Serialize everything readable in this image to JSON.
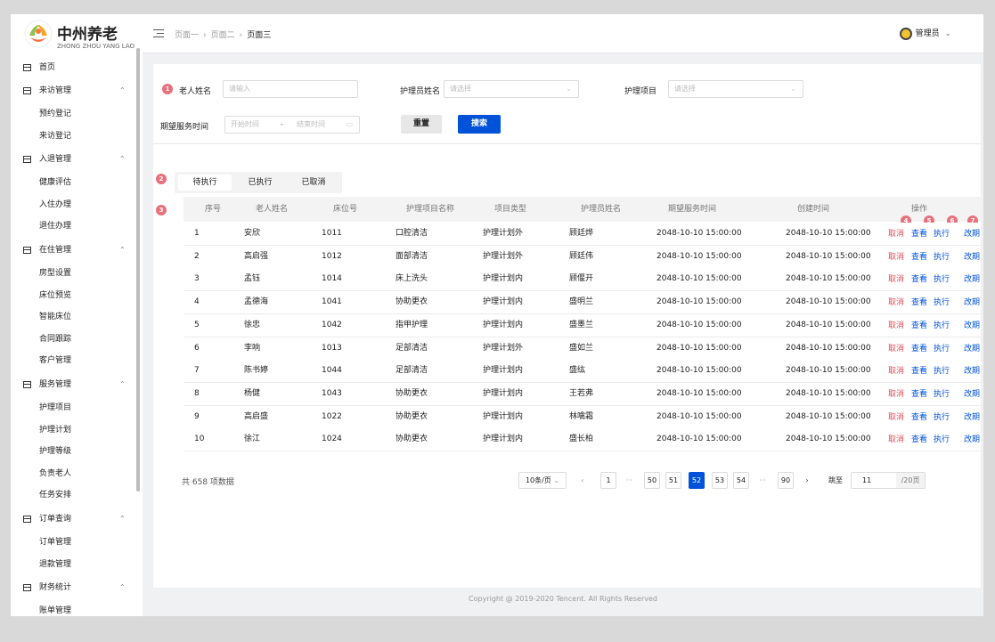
{
  "brand": {
    "name_cn": "中州养老",
    "name_en": "ZHONG ZHOU YANG LAO"
  },
  "header": {
    "breadcrumb": [
      "页面一",
      "页面二",
      "页面三"
    ],
    "user_label": "管理员",
    "menu_icon": "menu-fold-icon"
  },
  "sidebar": {
    "items": [
      {
        "label": "首页",
        "icon": "module-icon",
        "expandable": false,
        "children": []
      },
      {
        "label": "来访管理",
        "icon": "module-icon",
        "expandable": true,
        "children": [
          "预约登记",
          "来访登记"
        ]
      },
      {
        "label": "入退管理",
        "icon": "module-icon",
        "expandable": true,
        "children": [
          "健康评估",
          "入住办理",
          "退住办理"
        ]
      },
      {
        "label": "在住管理",
        "icon": "module-icon",
        "expandable": true,
        "children": [
          "房型设置",
          "床位预览",
          "智能床位",
          "合同跟踪",
          "客户管理"
        ]
      },
      {
        "label": "服务管理",
        "icon": "module-icon",
        "expandable": true,
        "children": [
          "护理项目",
          "护理计划",
          "护理等级",
          "负责老人",
          "任务安排"
        ]
      },
      {
        "label": "订单查询",
        "icon": "module-icon",
        "expandable": true,
        "children": [
          "订单管理",
          "退款管理"
        ]
      },
      {
        "label": "财务统计",
        "icon": "module-icon",
        "expandable": true,
        "children": [
          "账单管理"
        ]
      }
    ]
  },
  "filters": {
    "elder_name": {
      "label": "老人姓名",
      "placeholder": "请输入"
    },
    "nurse_name": {
      "label": "护理员姓名",
      "placeholder": "请选择"
    },
    "care_item": {
      "label": "护理项目",
      "placeholder": "请选择"
    },
    "service_time": {
      "label": "期望服务时间",
      "start_placeholder": "开始时间",
      "end_placeholder": "结束时间",
      "separator": "-"
    },
    "reset_label": "重置",
    "search_label": "搜索"
  },
  "tabs": [
    "待执行",
    "已执行",
    "已取消"
  ],
  "active_tab": 0,
  "table": {
    "columns": [
      "序号",
      "老人姓名",
      "床位号",
      "护理项目名称",
      "项目类型",
      "护理员姓名",
      "期望服务时间",
      "创建时间",
      "操作"
    ],
    "actions": [
      "取消",
      "查看",
      "执行",
      "改期"
    ],
    "rows": [
      [
        "1",
        "安欣",
        "1011",
        "口腔清洁",
        "护理计划外",
        "顾廷烨",
        "2048-10-10 15:00:00",
        "2048-10-10 15:00:00"
      ],
      [
        "2",
        "高启强",
        "1012",
        "面部清洁",
        "护理计划外",
        "顾廷伟",
        "2048-10-10 15:00:00",
        "2048-10-10 15:00:00"
      ],
      [
        "3",
        "孟钰",
        "1014",
        "床上洗头",
        "护理计划内",
        "顾偃开",
        "2048-10-10 15:00:00",
        "2048-10-10 15:00:00"
      ],
      [
        "4",
        "孟德海",
        "1041",
        "协助更衣",
        "护理计划内",
        "盛明兰",
        "2048-10-10 15:00:00",
        "2048-10-10 15:00:00"
      ],
      [
        "5",
        "徐忠",
        "1042",
        "指甲护理",
        "护理计划内",
        "盛墨兰",
        "2048-10-10 15:00:00",
        "2048-10-10 15:00:00"
      ],
      [
        "6",
        "李响",
        "1013",
        "足部清洁",
        "护理计划外",
        "盛如兰",
        "2048-10-10 15:00:00",
        "2048-10-10 15:00:00"
      ],
      [
        "7",
        "陈书婷",
        "1044",
        "足部清洁",
        "护理计划内",
        "盛纮",
        "2048-10-10 15:00:00",
        "2048-10-10 15:00:00"
      ],
      [
        "8",
        "杨健",
        "1043",
        "协助更衣",
        "护理计划内",
        "王若弗",
        "2048-10-10 15:00:00",
        "2048-10-10 15:00:00"
      ],
      [
        "9",
        "高启盛",
        "1022",
        "协助更衣",
        "护理计划内",
        "林噙霜",
        "2048-10-10 15:00:00",
        "2048-10-10 15:00:00"
      ],
      [
        "10",
        "徐江",
        "1024",
        "协助更衣",
        "护理计划内",
        "盛长柏",
        "2048-10-10 15:00:00",
        "2048-10-10 15:00:00"
      ]
    ]
  },
  "pagination": {
    "total_text": "共 658 项数据",
    "page_size": "10条/页",
    "pages": [
      "1",
      "50",
      "51",
      "52",
      "53",
      "54",
      "90"
    ],
    "current": "52",
    "ellipsis": "···",
    "prev": "‹",
    "next": "›",
    "jump_label": "跳至",
    "jump_value": "11",
    "jump_total": "/20页"
  },
  "badges": [
    "1",
    "2",
    "3",
    "4",
    "5",
    "6",
    "7"
  ],
  "footer": "Copyright @ 2019-2020 Tencent. All Rights Reserved",
  "colors": {
    "primary": "#0052d9",
    "danger": "#e34d59",
    "badge": "#e8707c"
  }
}
